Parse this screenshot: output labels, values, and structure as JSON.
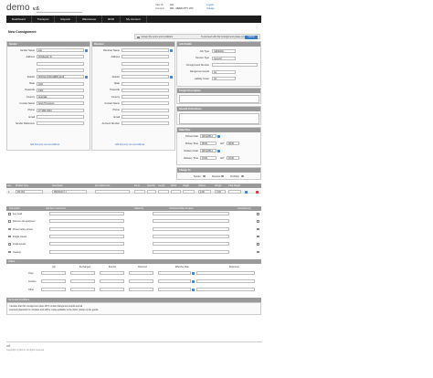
{
  "app": {
    "logo": "demo",
    "version": "v.6"
  },
  "user": {
    "user_id_label": "User id:",
    "user_id": "test",
    "account_label": "Account:",
    "account": "001 - DEMO PTY LTD",
    "logout": "Logout",
    "change": "change"
  },
  "nav": [
    "Dashboard",
    "Transport",
    "Reports",
    "Warehouse",
    "RFID",
    "My Account"
  ],
  "page_title": "New Consignment",
  "toolbar": {
    "accept_label": "I accept the terms and conditions",
    "proceed_label": "To proceed with this Consignment please press",
    "submit": "Submit"
  },
  "sender": {
    "header": "Sender",
    "fields": [
      {
        "label": "Sender Name",
        "value": "test"
      },
      {
        "label": "Address",
        "value": "20 Ebsolon St"
      },
      {
        "label": "",
        "value": ""
      },
      {
        "label": "",
        "value": ""
      },
      {
        "label": "Suburb",
        "value": "WOOLLOONGABBA 4102"
      },
      {
        "label": "State",
        "value": "QLD"
      },
      {
        "label": "Postcode",
        "value": "4102"
      },
      {
        "label": "Country",
        "value": "Australia"
      },
      {
        "label": "Contact Name",
        "value": "Scott Thompson"
      },
      {
        "label": "Phone",
        "value": "07 3391 8444"
      },
      {
        "label": "Email",
        "value": ""
      },
      {
        "label": "Sender Reference",
        "value": ""
      }
    ],
    "add_link": "Add this entry as new Address"
  },
  "receiver": {
    "header": "Receiver",
    "fields": [
      {
        "label": "Receiver Name",
        "value": ""
      },
      {
        "label": "Address",
        "value": ""
      },
      {
        "label": "",
        "value": ""
      },
      {
        "label": "",
        "value": ""
      },
      {
        "label": "Suburb",
        "value": ""
      },
      {
        "label": "State",
        "value": ""
      },
      {
        "label": "Postcode",
        "value": ""
      },
      {
        "label": "Country",
        "value": ""
      },
      {
        "label": "Contact Name",
        "value": ""
      },
      {
        "label": "Phone",
        "value": ""
      },
      {
        "label": "Email",
        "value": ""
      },
      {
        "label": "Account Number",
        "value": ""
      }
    ],
    "add_link": "Add this entry as new Address"
  },
  "job": {
    "header": "Job Details",
    "fields": [
      {
        "label": "Job Type",
        "value": "GENERAL"
      },
      {
        "label": "Service Type",
        "value": "General"
      },
      {
        "label": "Consignment Number",
        "value": ""
      },
      {
        "label": "Dangerous Goods",
        "value": "No"
      },
      {
        "label": "Liability Cover",
        "value": "No"
      }
    ],
    "freight_header": "Freight Description",
    "special_header": "Special Instructions",
    "date_header": "Date/Time",
    "dates": [
      {
        "label": "Pickup Date",
        "value": "28/11/2014"
      },
      {
        "label": "Pickup Time",
        "value": "08:00",
        "to": "AFT",
        "to_value": "08:00"
      },
      {
        "label": "Delivery Date",
        "value": "28/11/2014"
      },
      {
        "label": "Delivery Time",
        "value": "15:00",
        "to": "AFT",
        "to_value": "15:00"
      }
    ],
    "charge_header": "Charge To",
    "charge_options": [
      "Sender",
      "Receiver",
      "3rd Party"
    ]
  },
  "items": {
    "headers": [
      "Line",
      "Product Type",
      "Description",
      "Item Reference",
      "Items",
      "Quantity",
      "Length",
      "Width",
      "Height",
      "Volume",
      "Weight",
      "Total Weight"
    ],
    "row": {
      "line": "1",
      "product": "PR-001",
      "description": "PRODUCT 1",
      "volume": "0.00",
      "weight": "0.00"
    }
  },
  "dg": {
    "headers": [
      "Description",
      "Add Item Comments",
      "Added by",
      "Comments Date Created",
      "Completed by"
    ],
    "rows": [
      "Key Lead",
      "Remove old equipment",
      "Phone before arrival",
      "Fragile Goods",
      "Install Goods",
      "Cleanup"
    ]
  },
  "pallets": {
    "header": "Pallets",
    "columns": [
      "Qty",
      "Exchanged",
      "Exempt",
      "Returned",
      "Effective Date",
      "Reference"
    ],
    "rows": [
      "Chep",
      "Loscam",
      "Other"
    ]
  },
  "terms": {
    "header": "Terms and Conditions",
    "text1": "I declare that this consignment does NOT contain Dangerous Goods and all",
    "text2": "required paperwork is complete and will be made available to the driver pickup up the goods."
  },
  "footer": {
    "logo": "v6",
    "copyright": "Copyright (c) Demo. All rights reserved."
  }
}
